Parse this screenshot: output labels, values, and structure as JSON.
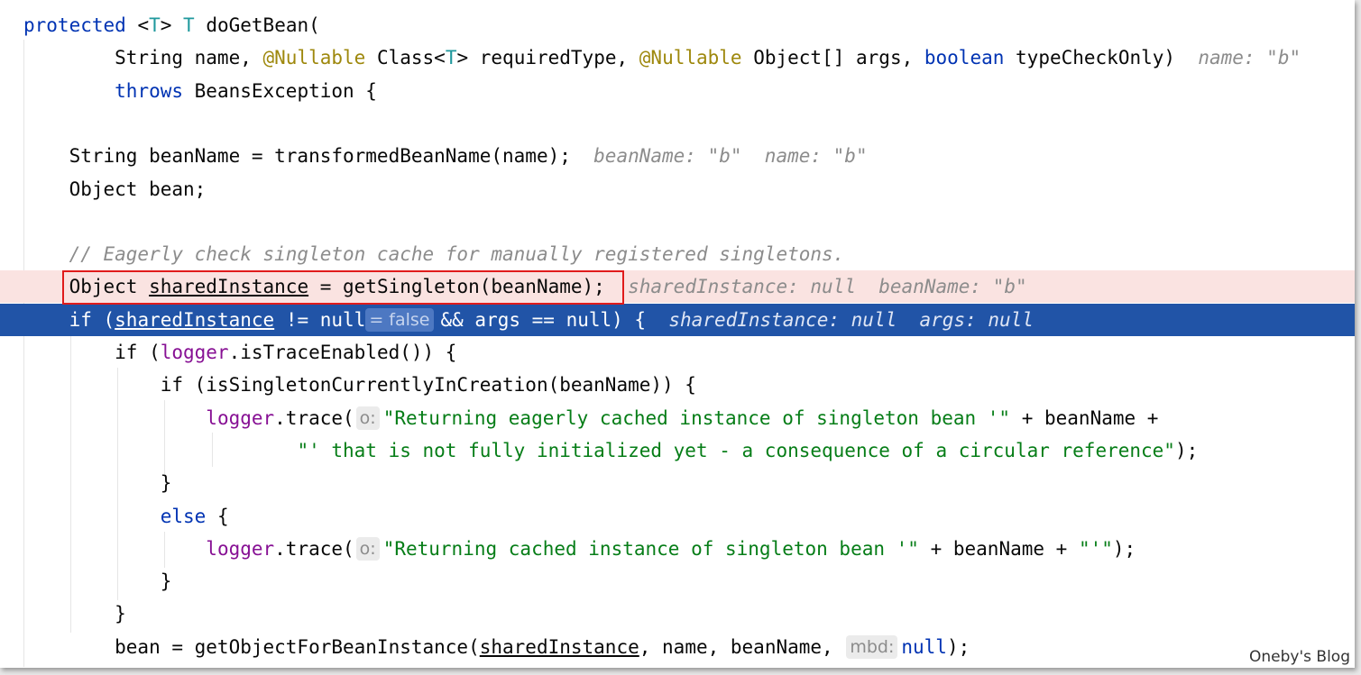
{
  "editor": {
    "lines": [
      [
        {
          "t": "protected",
          "c": "kw"
        },
        {
          "t": " <"
        },
        {
          "t": "T",
          "c": "tp"
        },
        {
          "t": "> "
        },
        {
          "t": "T",
          "c": "tp"
        },
        {
          "t": " doGetBean("
        }
      ],
      [
        {
          "t": "        String name, "
        },
        {
          "t": "@Nullable",
          "c": "ann"
        },
        {
          "t": " Class<"
        },
        {
          "t": "T",
          "c": "tp"
        },
        {
          "t": "> requiredType, "
        },
        {
          "t": "@Nullable",
          "c": "ann"
        },
        {
          "t": " Object[] args, "
        },
        {
          "t": "boolean",
          "c": "kw"
        },
        {
          "t": " typeCheckOnly)  "
        },
        {
          "t": "name: \"b\"",
          "c": "hint"
        }
      ],
      [
        {
          "t": "        "
        },
        {
          "t": "throws",
          "c": "kw"
        },
        {
          "t": " BeansException {"
        }
      ],
      [],
      [
        {
          "t": "    String beanName = transformedBeanName(name);  "
        },
        {
          "t": "beanName: \"b\"  name: \"b\"",
          "c": "hint"
        }
      ],
      [
        {
          "t": "    Object bean;"
        }
      ],
      [],
      [
        {
          "t": "    // Eagerly check singleton cache for manually registered singletons.",
          "c": "cmt"
        }
      ],
      [
        {
          "t": "    Object "
        },
        {
          "t": "sharedInstance",
          "c": "u"
        },
        {
          "t": " = getSingleton(beanName);  "
        },
        {
          "t": "sharedInstance: null  beanName: \"b\"",
          "c": "hint"
        }
      ],
      [
        {
          "t": "    if ("
        },
        {
          "t": "sharedInstance",
          "c": "u"
        },
        {
          "t": " != null"
        },
        {
          "t": "= false",
          "c": "inlay val"
        },
        {
          "t": "&& args == null) {  "
        },
        {
          "t": "sharedInstance: null  args: null",
          "c": "hint"
        }
      ],
      [
        {
          "t": "        if ("
        },
        {
          "t": "logger",
          "c": "fld"
        },
        {
          "t": ".isTraceEnabled()) {"
        }
      ],
      [
        {
          "t": "            if (isSingletonCurrentlyInCreation(beanName)) {"
        }
      ],
      [
        {
          "t": "                "
        },
        {
          "t": "logger",
          "c": "fld"
        },
        {
          "t": ".trace("
        },
        {
          "t": "o:",
          "c": "inlay"
        },
        {
          "t": "\"Returning eagerly cached instance of singleton bean '\"",
          "c": "str"
        },
        {
          "t": " + beanName +"
        }
      ],
      [
        {
          "t": "                        "
        },
        {
          "t": "\"' that is not fully initialized yet - a consequence of a circular reference\"",
          "c": "str"
        },
        {
          "t": ");"
        }
      ],
      [
        {
          "t": "            }"
        }
      ],
      [
        {
          "t": "            "
        },
        {
          "t": "else",
          "c": "kw"
        },
        {
          "t": " {"
        }
      ],
      [
        {
          "t": "                "
        },
        {
          "t": "logger",
          "c": "fld"
        },
        {
          "t": ".trace("
        },
        {
          "t": "o:",
          "c": "inlay"
        },
        {
          "t": "\"Returning cached instance of singleton bean '\"",
          "c": "str"
        },
        {
          "t": " + beanName + "
        },
        {
          "t": "\"'\"",
          "c": "str"
        },
        {
          "t": ");"
        }
      ],
      [
        {
          "t": "            }"
        }
      ],
      [
        {
          "t": "        }"
        }
      ],
      [
        {
          "t": "        bean = getObjectForBeanInstance("
        },
        {
          "t": "sharedInstance",
          "c": "u"
        },
        {
          "t": ", name, beanName, "
        },
        {
          "t": "mbd:",
          "c": "inlay"
        },
        {
          "t": "null",
          "c": "kw"
        },
        {
          "t": ");"
        }
      ]
    ],
    "breakpoint_line": 8,
    "execution_line": 9
  },
  "watermark": "Oneby's Blog",
  "colors": {
    "keyword": "#0033b3",
    "annotation": "#9e880d",
    "type_param": "#20999d",
    "field": "#871094",
    "string": "#067d17",
    "comment": "#8c8c8c",
    "breakpoint_bg": "#fae3e1",
    "execution_bg": "#2154a7",
    "highlight_border": "#e01b1b"
  }
}
